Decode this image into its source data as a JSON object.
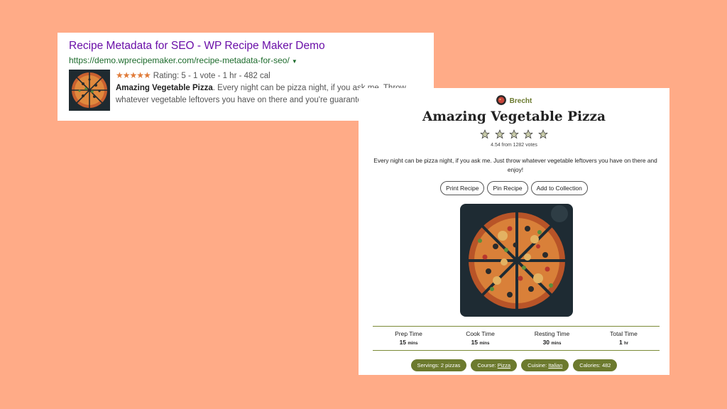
{
  "serp": {
    "title": "Recipe Metadata for SEO - WP Recipe Maker Demo",
    "url": "https://demo.wprecipemaker.com/recipe-metadata-for-seo/",
    "stars": "★★★★★",
    "rating_line": "Rating: 5 - 1 vote - 1 hr - 482 cal",
    "desc_bold": "Amazing Vegetable Pizza",
    "desc_text": ". Every night can be pizza night, if you ask me. Throw whatever vegetable leftovers you have on there and you're guaranteed a ...",
    "rating_color": "#e07b39"
  },
  "recipe": {
    "author": "Brecht",
    "title": "Amazing Vegetable Pizza",
    "rating": 4.54,
    "votes_text": "4.54 from 1282 votes",
    "summary": "Every night can be pizza night, if you ask me. Just throw whatever vegetable leftovers you have on there and enjoy!",
    "buttons": [
      "Print Recipe",
      "Pin Recipe",
      "Add to Collection"
    ],
    "times": [
      {
        "label": "Prep Time",
        "value": "15",
        "unit": "mins"
      },
      {
        "label": "Cook Time",
        "value": "15",
        "unit": "mins"
      },
      {
        "label": "Resting Time",
        "value": "30",
        "unit": "mins"
      },
      {
        "label": "Total Time",
        "value": "1",
        "unit": "hr"
      }
    ],
    "tags": {
      "servings": "Servings: 2 pizzas",
      "course_label": "Course: ",
      "course_value": "Pizza",
      "cuisine_label": "Cuisine: ",
      "cuisine_value": "Italian",
      "calories": "Calories: 482"
    },
    "accent_color": "#6c7a2e"
  }
}
